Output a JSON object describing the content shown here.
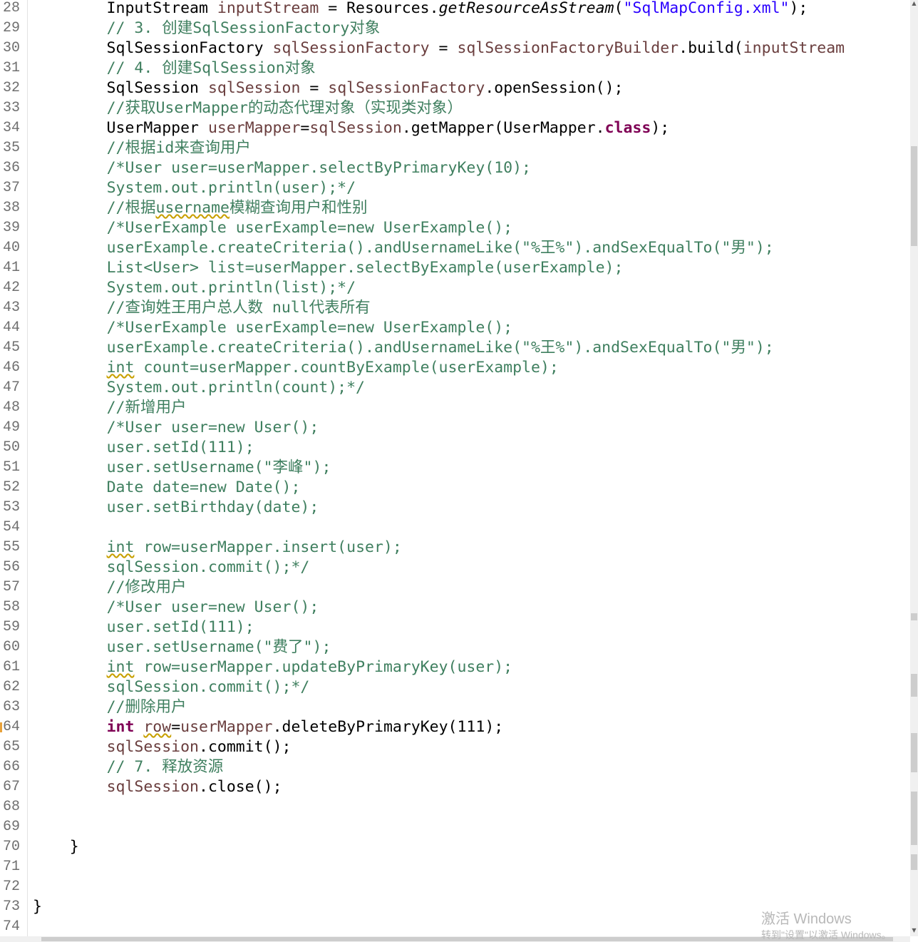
{
  "editor": {
    "lines": [
      {
        "n": "28",
        "tokens": [
          {
            "t": "        InputStream "
          },
          {
            "t": "inputStream",
            "c": "v"
          },
          {
            "t": " = Resources."
          },
          {
            "t": "getResourceAsStream",
            "c": "i"
          },
          {
            "t": "("
          },
          {
            "t": "\"SqlMapConfig.xml\"",
            "c": "s"
          },
          {
            "t": ");"
          }
        ]
      },
      {
        "n": "29",
        "tokens": [
          {
            "t": "        "
          },
          {
            "t": "// 3. 创建SqlSessionFactory对象",
            "c": "c"
          }
        ]
      },
      {
        "n": "30",
        "tokens": [
          {
            "t": "        SqlSessionFactory "
          },
          {
            "t": "sqlSessionFactory",
            "c": "v"
          },
          {
            "t": " = "
          },
          {
            "t": "sqlSessionFactoryBuilder",
            "c": "v"
          },
          {
            "t": ".build("
          },
          {
            "t": "inputStream",
            "c": "v"
          }
        ]
      },
      {
        "n": "31",
        "tokens": [
          {
            "t": "        "
          },
          {
            "t": "// 4. 创建SqlSession对象",
            "c": "c"
          }
        ]
      },
      {
        "n": "32",
        "tokens": [
          {
            "t": "        SqlSession "
          },
          {
            "t": "sqlSession",
            "c": "v"
          },
          {
            "t": " = "
          },
          {
            "t": "sqlSessionFactory",
            "c": "v"
          },
          {
            "t": ".openSession();"
          }
        ]
      },
      {
        "n": "33",
        "tokens": [
          {
            "t": "        "
          },
          {
            "t": "//获取UserMapper的动态代理对象（实现类对象）",
            "c": "c"
          }
        ]
      },
      {
        "n": "34",
        "tokens": [
          {
            "t": "        UserMapper "
          },
          {
            "t": "userMapper",
            "c": "v"
          },
          {
            "t": "="
          },
          {
            "t": "sqlSession",
            "c": "v"
          },
          {
            "t": ".getMapper(UserMapper."
          },
          {
            "t": "class",
            "c": "k"
          },
          {
            "t": ");"
          }
        ]
      },
      {
        "n": "35",
        "tokens": [
          {
            "t": "        "
          },
          {
            "t": "//根据id来查询用户",
            "c": "c"
          }
        ]
      },
      {
        "n": "36",
        "tokens": [
          {
            "t": "        "
          },
          {
            "t": "/*User user=userMapper.selectByPrimaryKey(10);",
            "c": "c"
          }
        ]
      },
      {
        "n": "37",
        "tokens": [
          {
            "t": "        "
          },
          {
            "t": "System.out.println(user);*/",
            "c": "c"
          }
        ]
      },
      {
        "n": "38",
        "tokens": [
          {
            "t": "        "
          },
          {
            "t": "//根据",
            "c": "c"
          },
          {
            "t": "username",
            "c": "w"
          },
          {
            "t": "模糊查询用户和性别",
            "c": "c"
          }
        ]
      },
      {
        "n": "39",
        "tokens": [
          {
            "t": "        "
          },
          {
            "t": "/*UserExample userExample=new UserExample();",
            "c": "c"
          }
        ]
      },
      {
        "n": "40",
        "tokens": [
          {
            "t": "        "
          },
          {
            "t": "userExample.createCriteria().andUsernameLike(\"%王%\").andSexEqualTo(\"男\");",
            "c": "c"
          }
        ]
      },
      {
        "n": "41",
        "tokens": [
          {
            "t": "        "
          },
          {
            "t": "List<User> list=userMapper.selectByExample(userExample);",
            "c": "c"
          }
        ]
      },
      {
        "n": "42",
        "tokens": [
          {
            "t": "        "
          },
          {
            "t": "System.out.println(list);*/",
            "c": "c"
          }
        ]
      },
      {
        "n": "43",
        "tokens": [
          {
            "t": "        "
          },
          {
            "t": "//查询姓王用户总人数 null代表所有",
            "c": "c"
          }
        ]
      },
      {
        "n": "44",
        "tokens": [
          {
            "t": "        "
          },
          {
            "t": "/*UserExample userExample=new UserExample();",
            "c": "c"
          }
        ]
      },
      {
        "n": "45",
        "tokens": [
          {
            "t": "        "
          },
          {
            "t": "userExample.createCriteria().andUsernameLike(\"%王%\").andSexEqualTo(\"男\");",
            "c": "c"
          }
        ]
      },
      {
        "n": "46",
        "tokens": [
          {
            "t": "        "
          },
          {
            "t": "int",
            "c": "w"
          },
          {
            "t": " count=userMapper.countByExample(userExample);",
            "c": "c"
          }
        ]
      },
      {
        "n": "47",
        "tokens": [
          {
            "t": "        "
          },
          {
            "t": "System.out.println(count);*/",
            "c": "c"
          }
        ]
      },
      {
        "n": "48",
        "tokens": [
          {
            "t": "        "
          },
          {
            "t": "//新增用户",
            "c": "c"
          }
        ]
      },
      {
        "n": "49",
        "tokens": [
          {
            "t": "        "
          },
          {
            "t": "/*User user=new User();",
            "c": "c"
          }
        ]
      },
      {
        "n": "50",
        "tokens": [
          {
            "t": "        "
          },
          {
            "t": "user.setId(111);",
            "c": "c"
          }
        ]
      },
      {
        "n": "51",
        "tokens": [
          {
            "t": "        "
          },
          {
            "t": "user.setUsername(\"李峰\");",
            "c": "c"
          }
        ]
      },
      {
        "n": "52",
        "tokens": [
          {
            "t": "        "
          },
          {
            "t": "Date date=new Date();",
            "c": "c"
          }
        ]
      },
      {
        "n": "53",
        "tokens": [
          {
            "t": "        "
          },
          {
            "t": "user.setBirthday(date);",
            "c": "c"
          }
        ]
      },
      {
        "n": "54",
        "tokens": []
      },
      {
        "n": "55",
        "tokens": [
          {
            "t": "        "
          },
          {
            "t": "int",
            "c": "w"
          },
          {
            "t": " row=userMapper.insert(user);",
            "c": "c"
          }
        ]
      },
      {
        "n": "56",
        "tokens": [
          {
            "t": "        "
          },
          {
            "t": "sqlSession.commit();*/",
            "c": "c"
          }
        ]
      },
      {
        "n": "57",
        "tokens": [
          {
            "t": "        "
          },
          {
            "t": "//修改用户",
            "c": "c"
          }
        ]
      },
      {
        "n": "58",
        "tokens": [
          {
            "t": "        "
          },
          {
            "t": "/*User user=new User();",
            "c": "c"
          }
        ]
      },
      {
        "n": "59",
        "tokens": [
          {
            "t": "        "
          },
          {
            "t": "user.setId(111);",
            "c": "c"
          }
        ]
      },
      {
        "n": "60",
        "tokens": [
          {
            "t": "        "
          },
          {
            "t": "user.setUsername(\"费了\");",
            "c": "c"
          }
        ]
      },
      {
        "n": "61",
        "tokens": [
          {
            "t": "        "
          },
          {
            "t": "int",
            "c": "w"
          },
          {
            "t": " row=userMapper.updateByPrimaryKey(user);",
            "c": "c"
          }
        ]
      },
      {
        "n": "62",
        "tokens": [
          {
            "t": "        "
          },
          {
            "t": "sqlSession.commit();*/",
            "c": "c"
          }
        ]
      },
      {
        "n": "63",
        "tokens": [
          {
            "t": "        "
          },
          {
            "t": "//删除用户",
            "c": "c"
          }
        ]
      },
      {
        "n": "64",
        "tokens": [
          {
            "t": "        "
          },
          {
            "t": "int",
            "c": "k"
          },
          {
            "t": " "
          },
          {
            "t": "row",
            "c": "wv"
          },
          {
            "t": "="
          },
          {
            "t": "userMapper",
            "c": "v"
          },
          {
            "t": ".deleteByPrimaryKey(111);"
          }
        ]
      },
      {
        "n": "65",
        "tokens": [
          {
            "t": "        "
          },
          {
            "t": "sqlSession",
            "c": "v"
          },
          {
            "t": ".commit();"
          }
        ]
      },
      {
        "n": "66",
        "tokens": [
          {
            "t": "        "
          },
          {
            "t": "// 7. 释放资源",
            "c": "c"
          }
        ]
      },
      {
        "n": "67",
        "tokens": [
          {
            "t": "        "
          },
          {
            "t": "sqlSession",
            "c": "v"
          },
          {
            "t": ".close();"
          }
        ]
      },
      {
        "n": "68",
        "tokens": []
      },
      {
        "n": "69",
        "tokens": []
      },
      {
        "n": "70",
        "tokens": [
          {
            "t": "    }"
          }
        ]
      },
      {
        "n": "71",
        "tokens": []
      },
      {
        "n": "72",
        "tokens": []
      },
      {
        "n": "73",
        "tokens": [
          {
            "t": "}"
          }
        ]
      },
      {
        "n": "74",
        "tokens": []
      }
    ]
  },
  "watermark": {
    "title": "激活 Windows",
    "subtitle": "转到\"设置\"以激活 Windows。"
  },
  "colors": {
    "comment": "#3f7f5f",
    "variable": "#6a3e3e",
    "string": "#2a00ff",
    "keyword": "#7f0055"
  }
}
